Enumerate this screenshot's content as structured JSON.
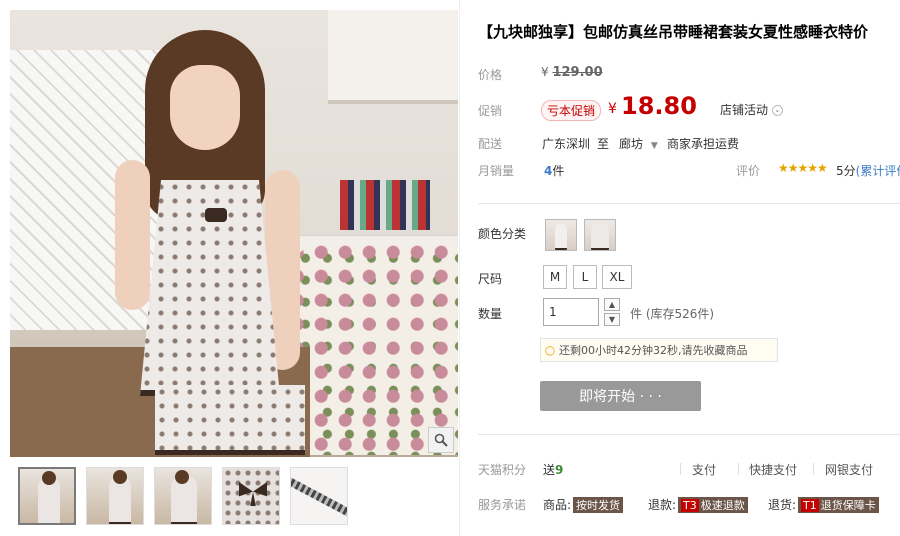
{
  "product": {
    "title": "【九块邮独享】包邮仿真丝吊带睡裙套装女夏性感睡衣特价",
    "price_label": "价格",
    "original_price_symbol": "¥",
    "original_price": "129.00",
    "promo_label": "促销",
    "promo_tag": "亏本促销",
    "promo_symbol": "¥",
    "promo_price": "18.80",
    "store_activity": "店铺活动",
    "delivery_label": "配送",
    "ship_from": "广东深圳",
    "ship_to_word": "至",
    "ship_to": "廊坊",
    "ship_fee": "商家承担运费",
    "monthly_sales_label": "月销量",
    "monthly_sales_value": "4",
    "monthly_sales_unit": "件",
    "review_label": "评价",
    "stars": "★★★★★",
    "score": "5分",
    "score_link": "(累计评价"
  },
  "options": {
    "color_label": "颜色分类",
    "size_label": "尺码",
    "sizes": [
      "M",
      "L",
      "XL"
    ],
    "quantity_label": "数量",
    "quantity_value": "1",
    "stock_text": "件 (库存526件)",
    "countdown_tip": "还剩00小时42分钟32秒,请先收藏商品",
    "buy_button": "即将开始 · · ·"
  },
  "service": {
    "mall_points_label": "天猫积分",
    "mall_points_prefix": "送",
    "mall_points_value": "9",
    "pay_options": [
      "支付",
      "快捷支付",
      "网银支付"
    ],
    "promise_label": "服务承诺",
    "promise_1_prefix": "商品:",
    "promise_1_badge": "按时发货",
    "promise_2_prefix": "退款:",
    "promise_2_code": "T3",
    "promise_2_badge": "极速退款",
    "promise_3_prefix": "退货:",
    "promise_3_code": "T1",
    "promise_3_badge": "退货保障卡"
  },
  "icons": {
    "zoom": "magnifier-icon",
    "dropdown": "chevron-down-icon",
    "qty_up": "arrow-up-icon",
    "qty_down": "arrow-down-icon",
    "tip": "lightbulb-icon"
  },
  "colors": {
    "accent_red": "#c40000",
    "link_blue": "#3c7cc4",
    "button_gray": "#999999"
  }
}
